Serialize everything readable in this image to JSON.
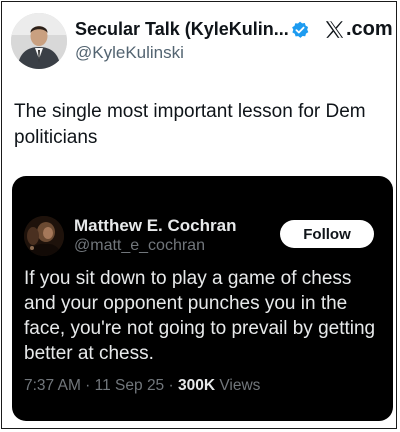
{
  "header": {
    "display_name": "Secular Talk (KyleKulin...",
    "handle": "@KyleKulinski",
    "brand": ".com",
    "verified_icon": "verified-badge-icon",
    "brand_icon": "x-logo-icon"
  },
  "tweet": {
    "text": "The single most important lesson for Dem politicians"
  },
  "quote": {
    "display_name": "Matthew E. Cochran",
    "handle": "@matt_e_cochran",
    "follow_label": "Follow",
    "text": "If you sit down to play a game of chess and your opponent punches you in the face, you're not going to prevail by getting better at chess.",
    "time": "7:37 AM",
    "separator": " · ",
    "date": "11 Sep 25",
    "views_count": "300K",
    "views_label": " Views"
  },
  "colors": {
    "verified": "#1d9bf0",
    "quote_background": "#000000",
    "quote_text": "#e7e9ea",
    "muted": "#71767b"
  }
}
